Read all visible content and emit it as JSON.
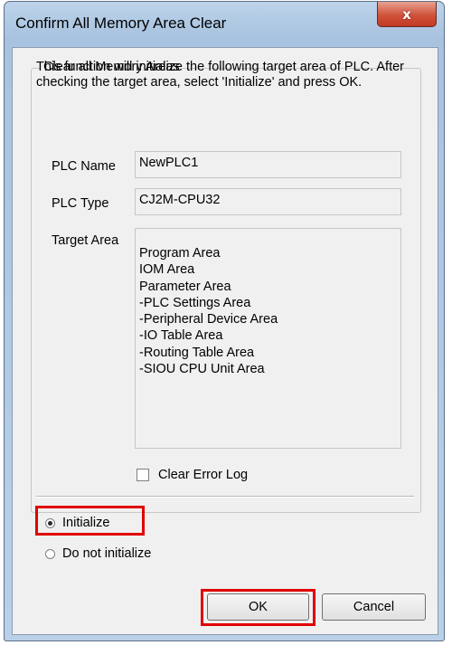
{
  "window": {
    "title": "Confirm All Memory Area Clear",
    "close_label": "x"
  },
  "group": {
    "legend": "Clear all Memory Areas",
    "description": "This function will initialize the following target area of PLC. After checking the target area, select 'Initialize' and press OK.",
    "plc_name": {
      "label": "PLC Name",
      "value": "NewPLC1"
    },
    "plc_type": {
      "label": "PLC Type",
      "value": "CJ2M-CPU32"
    },
    "target_area": {
      "label": "Target Area",
      "items": [
        "Program Area",
        "IOM Area",
        "Parameter Area",
        "-PLC Settings Area",
        "-Peripheral Device Area",
        "-IO Table Area",
        "-Routing Table Area",
        "-SIOU CPU Unit Area"
      ]
    },
    "clear_error_log": {
      "label": "Clear Error Log",
      "checked": false
    }
  },
  "options": {
    "initialize": {
      "label": "Initialize",
      "selected": true
    },
    "do_not_initialize": {
      "label": "Do not initialize",
      "selected": false
    }
  },
  "buttons": {
    "ok": "OK",
    "cancel": "Cancel"
  },
  "colors": {
    "highlight": "#e00000",
    "close_button": "#c94a35",
    "frame": "#b0c8e4"
  }
}
